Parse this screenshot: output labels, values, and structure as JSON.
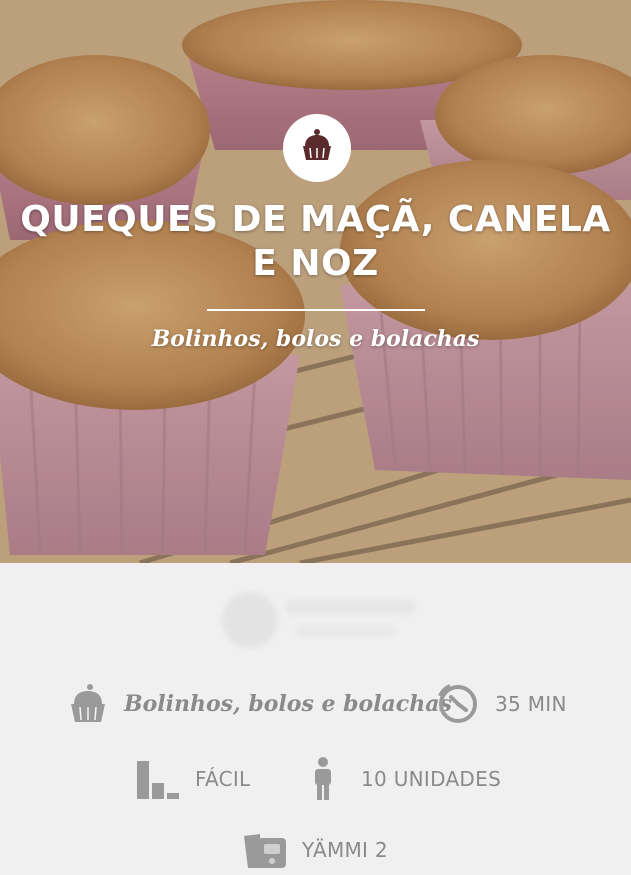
{
  "recipe": {
    "title": "QUEQUES DE MAÇÃ, CANELA E NOZ",
    "category": "Bolinhos, bolos e bolachas",
    "hero_icon": "cupcake-icon"
  },
  "details": {
    "category_label": "Bolinhos, bolos e bolachas",
    "category_icon": "cupcake-icon",
    "time_label": "35 MIN",
    "time_icon": "timer-icon",
    "difficulty_label": "FÁCIL",
    "difficulty_icon": "difficulty-bars-icon",
    "servings_label": "10 UNIDADES",
    "servings_icon": "person-icon",
    "device_label": "YÄMMI 2",
    "device_icon": "food-processor-icon"
  },
  "colors": {
    "text_muted": "#8a8a8a",
    "background": "#f0f0f0",
    "hero_text": "#ffffff"
  }
}
